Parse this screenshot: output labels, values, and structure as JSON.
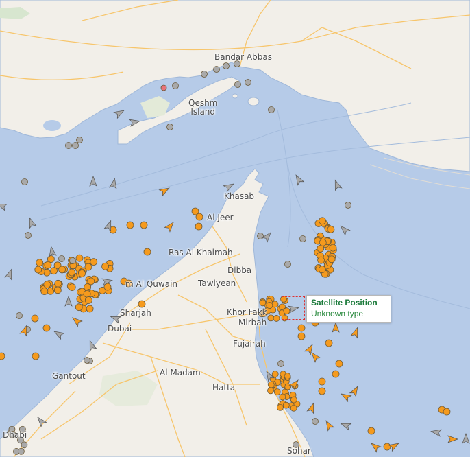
{
  "map": {
    "colors": {
      "sea": "#b6cbe8",
      "land": "#f2efe9",
      "road": "#f7c56b",
      "cargo_vessel": "#f59a1d",
      "other_vessel": "#a9a9a9",
      "selected_outline": "#dd3333",
      "tooltip_title": "#1a7a3a"
    },
    "places": [
      {
        "id": "bandar-abbas",
        "label": "Bandar Abbas"
      },
      {
        "id": "qeshm-island",
        "label": "Qeshm\nIsland"
      },
      {
        "id": "khasab",
        "label": "Khasab"
      },
      {
        "id": "al-jeer",
        "label": "Al Jeer"
      },
      {
        "id": "ras-al-khaimah",
        "label": "Ras Al Khaimah"
      },
      {
        "id": "dibba",
        "label": "Dibba"
      },
      {
        "id": "umm-al-quwain",
        "label": "m Al Quwain"
      },
      {
        "id": "tawiyean",
        "label": "Tawiyean"
      },
      {
        "id": "sharjah",
        "label": "Sharjah"
      },
      {
        "id": "dubai",
        "label": "Dubai"
      },
      {
        "id": "khor-fakkan",
        "label": "Khor Fakk"
      },
      {
        "id": "mirbah",
        "label": "Mirbah"
      },
      {
        "id": "fujairah",
        "label": "Fujairah"
      },
      {
        "id": "gantout",
        "label": "Gantout"
      },
      {
        "id": "al-madam",
        "label": "Al Madam"
      },
      {
        "id": "hatta",
        "label": "Hatta"
      },
      {
        "id": "abu-dhabi",
        "label": "Dhabi"
      },
      {
        "id": "sohar",
        "label": "Sohar"
      }
    ],
    "selected_vessel": {
      "title": "Satellite Position",
      "type": "Unknown type"
    }
  }
}
